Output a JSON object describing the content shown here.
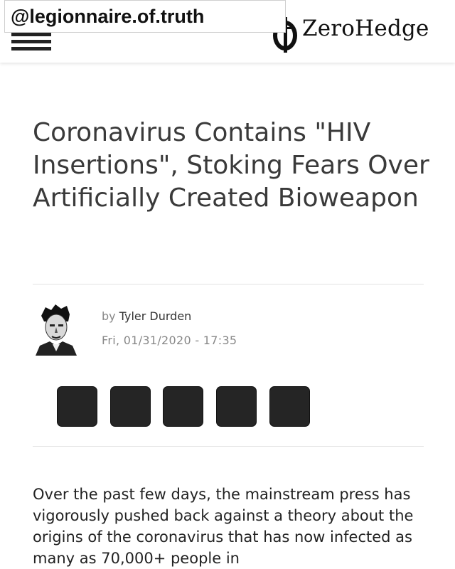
{
  "watermark": {
    "handle": "@legionnaire.of.truth"
  },
  "header": {
    "site_name": "ZeroHedge",
    "menu_icon": "hamburger-menu-icon"
  },
  "article": {
    "title": "Coronavirus Contains \"HIV Insertions\", Stoking Fears Over Artificially Created Bioweapon",
    "by_prefix": "by",
    "author": "Tyler Durden",
    "date": "Fri, 01/31/2020 - 17:35",
    "body": "Over the past few days, the mainstream press has vigorously pushed back against a theory about the origins of the coronavirus that has now infected as many as 70,000+ people in"
  },
  "share_buttons": [
    {
      "icon": "share-button-1"
    },
    {
      "icon": "share-button-2"
    },
    {
      "icon": "share-button-3"
    },
    {
      "icon": "share-button-4"
    },
    {
      "icon": "share-button-5"
    }
  ],
  "colors": {
    "share_button_bg": "#252525",
    "title": "#3a3a3a",
    "meta": "#888888"
  }
}
